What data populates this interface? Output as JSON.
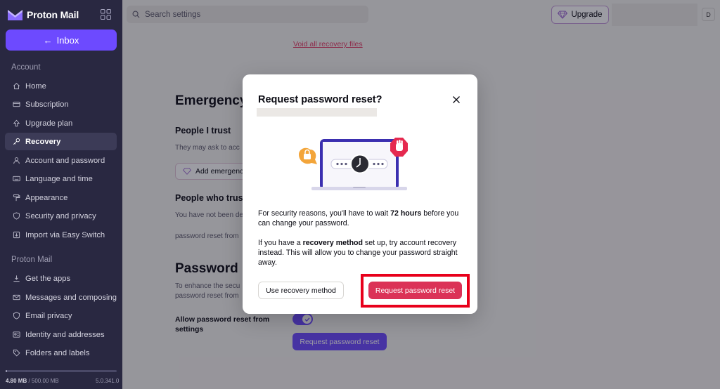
{
  "sidebar": {
    "brand": "Proton Mail",
    "inbox_label": "Inbox",
    "sections": [
      {
        "title": "Account",
        "items": [
          {
            "label": "Home",
            "icon": "home-icon"
          },
          {
            "label": "Subscription",
            "icon": "credit-card-icon"
          },
          {
            "label": "Upgrade plan",
            "icon": "upgrade-icon"
          },
          {
            "label": "Recovery",
            "icon": "key-icon",
            "active": true
          },
          {
            "label": "Account and password",
            "icon": "user-icon"
          },
          {
            "label": "Language and time",
            "icon": "keyboard-icon"
          },
          {
            "label": "Appearance",
            "icon": "paint-roller-icon"
          },
          {
            "label": "Security and privacy",
            "icon": "shield-icon"
          },
          {
            "label": "Import via Easy Switch",
            "icon": "import-icon"
          }
        ]
      },
      {
        "title": "Proton Mail",
        "items": [
          {
            "label": "Get the apps",
            "icon": "download-icon"
          },
          {
            "label": "Messages and composing",
            "icon": "envelope-icon"
          },
          {
            "label": "Email privacy",
            "icon": "shield-icon"
          },
          {
            "label": "Identity and addresses",
            "icon": "identity-icon"
          },
          {
            "label": "Folders and labels",
            "icon": "tag-icon"
          }
        ]
      }
    ],
    "storage": {
      "used": "4.80 MB",
      "separator": " / ",
      "total": "500.00 MB",
      "fraction": 0.01
    },
    "version": "5.0.341.0"
  },
  "topbar": {
    "search_placeholder": "Search settings",
    "upgrade_label": "Upgrade",
    "avatar_initial": "D"
  },
  "page": {
    "void_link": "Void all recovery files",
    "emergency_heading": "Emergency",
    "trust_heading": "People I trust",
    "trust_text": "They may ask to acc",
    "add_button": "Add emergenc",
    "who_heading": "People who trus",
    "who_text": "You have not been de",
    "who_text2": "password reset from",
    "password_heading": "Password",
    "enhance_text_1": "To enhance the secu",
    "enhance_text_2": "password reset from",
    "allow_label": "Allow password reset from settings",
    "toggle_on": true,
    "request_button": "Request password reset"
  },
  "modal": {
    "title": "Request password reset?",
    "p1_before": "For security reasons, you'll have to wait ",
    "p1_bold": "72 hours",
    "p1_after": " before you can change your password.",
    "p2_before": "If you have a ",
    "p2_bold": "recovery method",
    "p2_after": " set up, try account recovery instead. This will allow you to change your password straight away.",
    "secondary_button": "Use recovery method",
    "primary_button": "Request password reset"
  },
  "colors": {
    "sidebar_bg": "#292841",
    "accent": "#6d4aff",
    "danger": "#db3257",
    "highlight": "#e8001b"
  }
}
